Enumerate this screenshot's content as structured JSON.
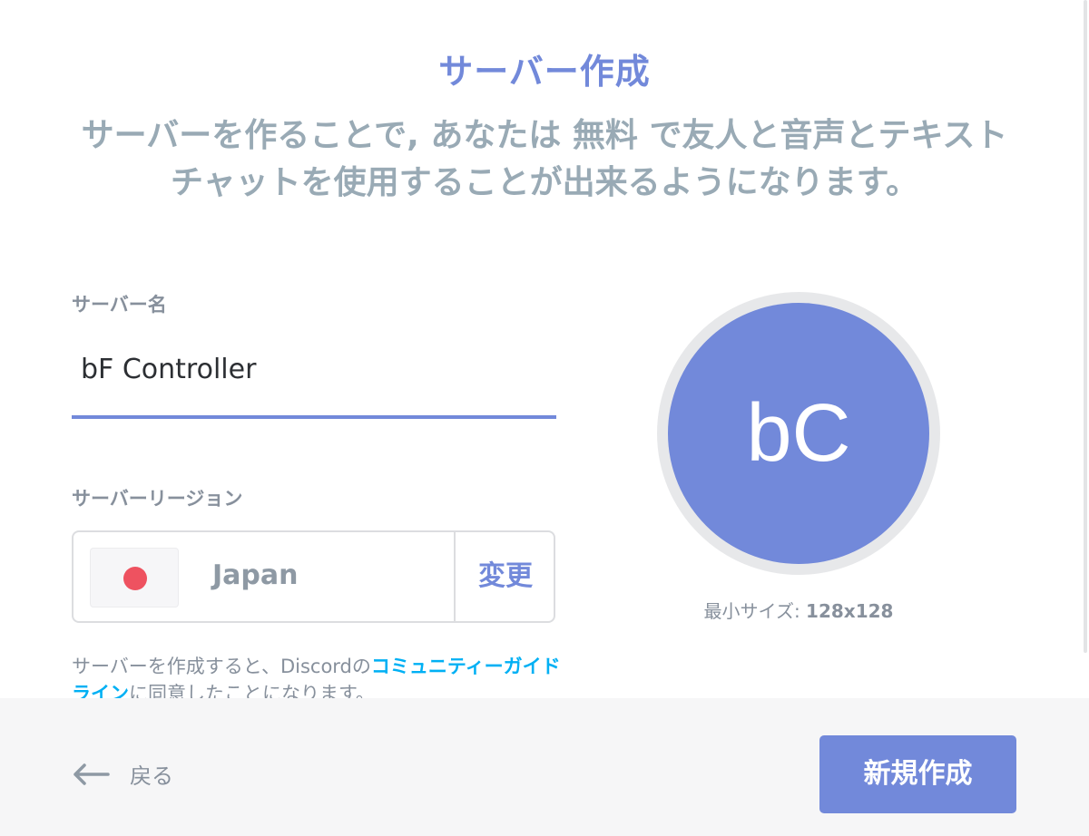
{
  "modal": {
    "title": "サーバー作成",
    "subtitle": "サーバーを作ることで, あなたは 無料 で友人と音声とテキストチャットを使用することが出来るようになります。"
  },
  "form": {
    "name_label": "サーバー名",
    "name_value": "bF Controller",
    "region_label": "サーバーリージョン",
    "region_name": "Japan",
    "region_flag_icon": "japan-flag-icon",
    "change_label": "変更"
  },
  "avatar": {
    "initials": "bC",
    "min_size_label": "最小サイズ: ",
    "min_size_value": "128x128",
    "color": "#7289da"
  },
  "terms": {
    "prefix": "サーバーを作成すると、Discordの",
    "link": "コミュニティーガイドライン",
    "suffix": "に同意したことになります。"
  },
  "footer": {
    "back_label": "戻る",
    "back_icon": "arrow-left-icon",
    "create_label": "新規作成"
  },
  "colors": {
    "accent": "#7289da",
    "link": "#00b0f4",
    "muted": "#99aab5"
  }
}
